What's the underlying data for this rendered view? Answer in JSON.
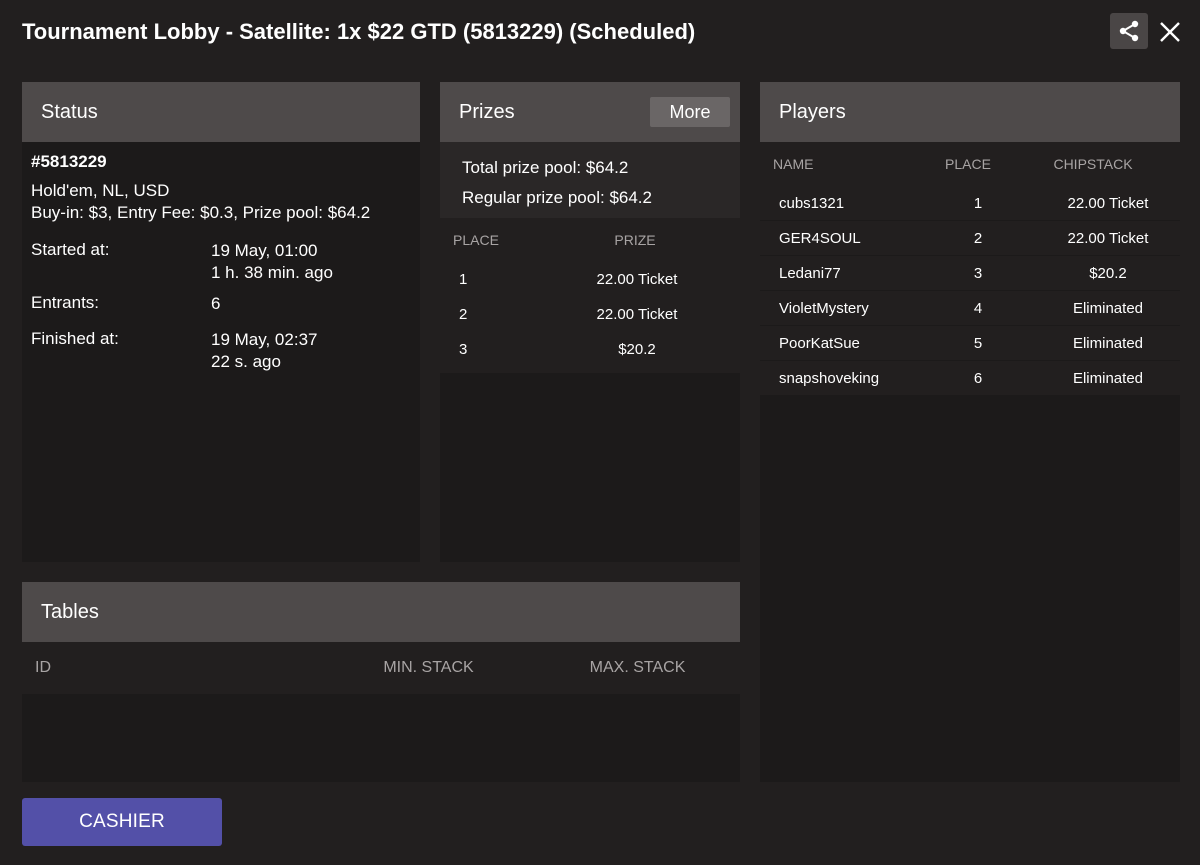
{
  "window": {
    "title": "Tournament Lobby - Satellite: 1x $22 GTD (5813229) (Scheduled)",
    "share_icon": "share-icon",
    "close_icon": "close-icon"
  },
  "status": {
    "header": "Status",
    "id": "#5813229",
    "game": "Hold'em, NL, USD",
    "buyin": "Buy-in: $3, Entry Fee: $0.3, Prize pool: $64.2",
    "started_label": "Started at:",
    "started_value": "19 May, 01:00",
    "started_ago": "1 h. 38 min. ago",
    "entrants_label": "Entrants:",
    "entrants_value": "6",
    "finished_label": "Finished at:",
    "finished_value": "19 May, 02:37",
    "finished_ago": "22 s. ago"
  },
  "prizes": {
    "header": "Prizes",
    "more_label": "More",
    "total_label": "Total prize pool:",
    "total_value": "$64.2",
    "regular_label": "Regular prize pool:",
    "regular_value": "$64.2",
    "columns": {
      "place": "PLACE",
      "prize": "PRIZE"
    },
    "rows": [
      {
        "place": "1",
        "prize": "22.00 Ticket"
      },
      {
        "place": "2",
        "prize": "22.00 Ticket"
      },
      {
        "place": "3",
        "prize": "$20.2"
      }
    ]
  },
  "players": {
    "header": "Players",
    "columns": {
      "name": "NAME",
      "place": "PLACE",
      "chipstack": "CHIPSTACK"
    },
    "rows": [
      {
        "name": "cubs1321",
        "place": "1",
        "chipstack": "22.00 Ticket"
      },
      {
        "name": "GER4SOUL",
        "place": "2",
        "chipstack": "22.00 Ticket"
      },
      {
        "name": "Ledani77",
        "place": "3",
        "chipstack": "$20.2"
      },
      {
        "name": "VioletMystery",
        "place": "4",
        "chipstack": "Eliminated"
      },
      {
        "name": "PoorKatSue",
        "place": "5",
        "chipstack": "Eliminated"
      },
      {
        "name": "snapshoveking",
        "place": "6",
        "chipstack": "Eliminated"
      }
    ]
  },
  "tables": {
    "header": "Tables",
    "columns": {
      "id": "ID",
      "min_stack": "MIN. STACK",
      "max_stack": "MAX. STACK"
    }
  },
  "footer": {
    "cashier_label": "CASHIER"
  },
  "colors": {
    "background": "#221f1f",
    "panel_header": "#4e4a4a",
    "accent_button": "#5350a8"
  }
}
